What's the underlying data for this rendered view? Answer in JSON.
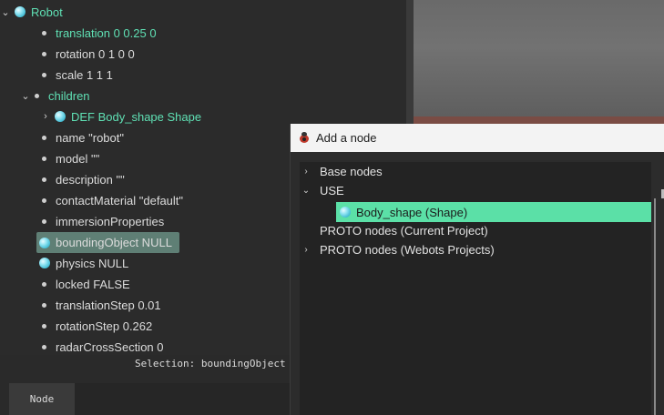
{
  "scene_tree": {
    "rows": [
      {
        "label": "Robot"
      },
      {
        "label": "translation 0 0.25 0"
      },
      {
        "label": "rotation 0 1 0 0"
      },
      {
        "label": "scale 1 1 1"
      },
      {
        "label": "children"
      },
      {
        "label": "DEF Body_shape Shape"
      },
      {
        "label": "name \"robot\""
      },
      {
        "label": "model \"\""
      },
      {
        "label": "description \"\""
      },
      {
        "label": "contactMaterial \"default\""
      },
      {
        "label": "immersionProperties"
      },
      {
        "label": "boundingObject NULL"
      },
      {
        "label": "physics NULL"
      },
      {
        "label": "locked FALSE"
      },
      {
        "label": "translationStep 0.01"
      },
      {
        "label": "rotationStep 0.262"
      },
      {
        "label": "radarCrossSection 0"
      }
    ]
  },
  "selection_info": "Selection: boundingObject",
  "bottom_tab": {
    "label": "Node"
  },
  "dialog": {
    "title": "Add a node",
    "tree": [
      {
        "label": "Base nodes"
      },
      {
        "label": "USE"
      },
      {
        "label": "Body_shape (Shape)"
      },
      {
        "label": "PROTO nodes (Current Project)"
      },
      {
        "label": "PROTO nodes (Webots Projects)"
      }
    ]
  },
  "colors": {
    "accent_green": "#5be0a7",
    "tree_text_green": "#5fe0b4",
    "selected_row": "#5f7f75"
  }
}
